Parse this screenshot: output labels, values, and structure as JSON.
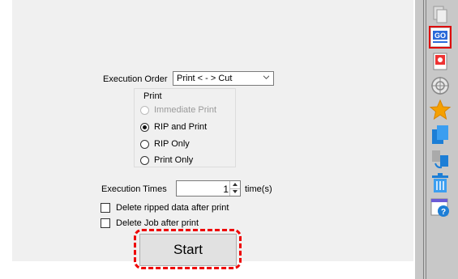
{
  "execution_order": {
    "label": "Execution Order",
    "value": "Print < - > Cut"
  },
  "print_group": {
    "title": "Print",
    "options": [
      {
        "label": "Immediate Print",
        "state": "disabled"
      },
      {
        "label": "RIP and Print",
        "state": "selected"
      },
      {
        "label": "RIP Only",
        "state": "unselected"
      },
      {
        "label": "Print Only",
        "state": "unselected"
      }
    ]
  },
  "execution_times": {
    "label": "Execution Times",
    "value": "1",
    "unit": "time(s)"
  },
  "checkboxes": [
    {
      "label": "Delete ripped data after print",
      "checked": false
    },
    {
      "label": "Delete Job after print",
      "checked": false
    }
  ],
  "start_button": {
    "label": "Start",
    "highlight_color": "#e00000"
  },
  "toolbar": {
    "icons": [
      "copy-icon",
      "go-icon",
      "job-settings-icon",
      "target-icon",
      "favorite-star-icon",
      "duplicate-icon",
      "transfer-icon",
      "trash-icon",
      "help-icon"
    ],
    "go_label": "GO"
  }
}
